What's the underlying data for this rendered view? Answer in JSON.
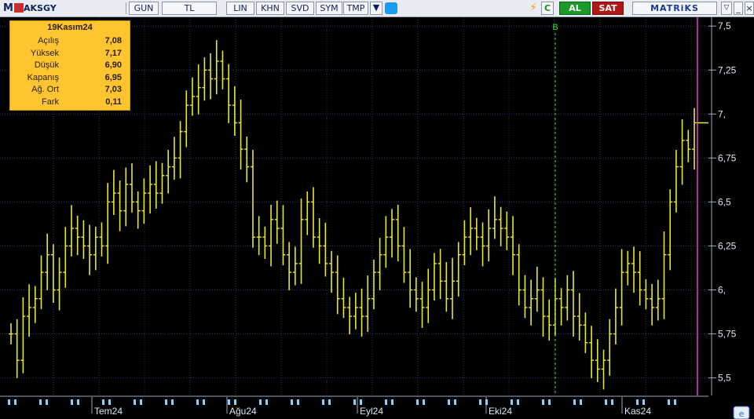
{
  "toolbar": {
    "logo": "M",
    "symbol": "AKSGY",
    "buttons": [
      "GUN",
      "TL",
      "LIN",
      "KHN",
      "SVD",
      "SYM",
      "TMP"
    ],
    "buy_label": "AL",
    "sell_label": "SAT",
    "brand": "MATRiKS"
  },
  "info": {
    "date": "19Kasım24",
    "rows": [
      {
        "label": "Açılış",
        "value": "7,08"
      },
      {
        "label": "Yüksek",
        "value": "7,17"
      },
      {
        "label": "Düşük",
        "value": "6,90"
      },
      {
        "label": "Kapanış",
        "value": "6,95"
      },
      {
        "label": "Ağ. Ort",
        "value": "7,03"
      },
      {
        "label": "Fark",
        "value": "0,11"
      }
    ]
  },
  "chart_data": {
    "type": "ohlc",
    "y_ticks": [
      "7,5",
      "7,25",
      "7,",
      "6,75",
      "6,5",
      "6,25",
      "6,",
      "5,75",
      "5,5"
    ],
    "ylim": [
      5.4,
      7.55
    ],
    "x_tick_labels": [
      "Tem24",
      "Ağu24",
      "Eyl24",
      "Eki24",
      "Kas24"
    ],
    "signal_marker": "B",
    "last_price": 6.95,
    "colors": {
      "bars": "#e8e82a",
      "grid": "#2a3a6a",
      "signal": "#33dd33",
      "cursor": "#b0309a",
      "axis_text": "#dfe6f5"
    },
    "closes": [
      5.75,
      5.6,
      5.85,
      5.9,
      5.95,
      6.1,
      6.2,
      6.0,
      6.1,
      6.25,
      6.35,
      6.3,
      6.25,
      6.2,
      6.3,
      6.25,
      6.5,
      6.55,
      6.45,
      6.6,
      6.5,
      6.45,
      6.55,
      6.6,
      6.55,
      6.65,
      6.7,
      6.75,
      6.9,
      7.05,
      7.1,
      7.15,
      7.25,
      7.2,
      7.3,
      7.2,
      7.05,
      6.95,
      6.8,
      6.7,
      6.3,
      6.3,
      6.25,
      6.4,
      6.35,
      6.2,
      6.1,
      6.15,
      6.4,
      6.5,
      6.3,
      6.25,
      6.15,
      6.1,
      5.95,
      5.9,
      5.85,
      5.9,
      5.85,
      5.95,
      6.1,
      6.2,
      6.3,
      6.4,
      6.25,
      6.1,
      6.0,
      5.95,
      5.9,
      6.0,
      6.15,
      6.05,
      5.95,
      6.05,
      6.2,
      6.3,
      6.35,
      6.3,
      6.25,
      6.35,
      6.4,
      6.35,
      6.3,
      6.2,
      6.0,
      5.9,
      5.95,
      6.0,
      5.85,
      5.8,
      5.95,
      5.9,
      6.0,
      5.85,
      5.8,
      5.7,
      5.6,
      5.55,
      5.6,
      5.75,
      5.9,
      6.1,
      6.15,
      6.1,
      6.0,
      5.95,
      5.9,
      5.95,
      6.2,
      6.5,
      6.7,
      6.85,
      6.8,
      6.95
    ]
  }
}
